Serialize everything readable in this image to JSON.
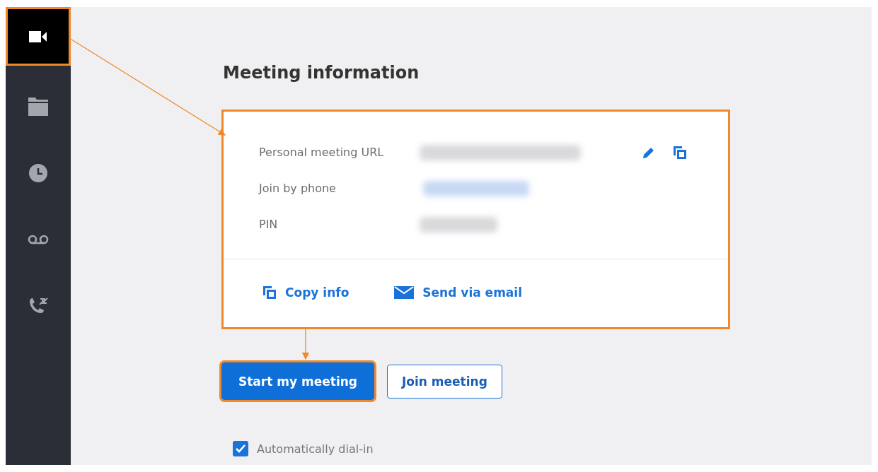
{
  "sidebar": {
    "items": [
      {
        "selected": true,
        "highlighted": true
      },
      {
        "selected": false,
        "highlighted": false
      },
      {
        "selected": false,
        "highlighted": false
      },
      {
        "selected": false,
        "highlighted": false
      },
      {
        "selected": false,
        "highlighted": false
      }
    ]
  },
  "heading": "Meeting information",
  "card": {
    "highlighted": true,
    "rows": [
      {
        "label": "Personal meeting URL"
      },
      {
        "label": "Join by phone"
      },
      {
        "label": "PIN"
      }
    ],
    "links": [
      {
        "label": "Copy info"
      },
      {
        "label": "Send via email"
      }
    ]
  },
  "buttons": [
    {
      "label": "Start my meeting",
      "kind": "primary",
      "highlighted": true
    },
    {
      "label": "Join meeting",
      "kind": "secondary",
      "highlighted": false
    }
  ],
  "auto_dial": {
    "label": "Automatically dial-in",
    "checked": true
  }
}
